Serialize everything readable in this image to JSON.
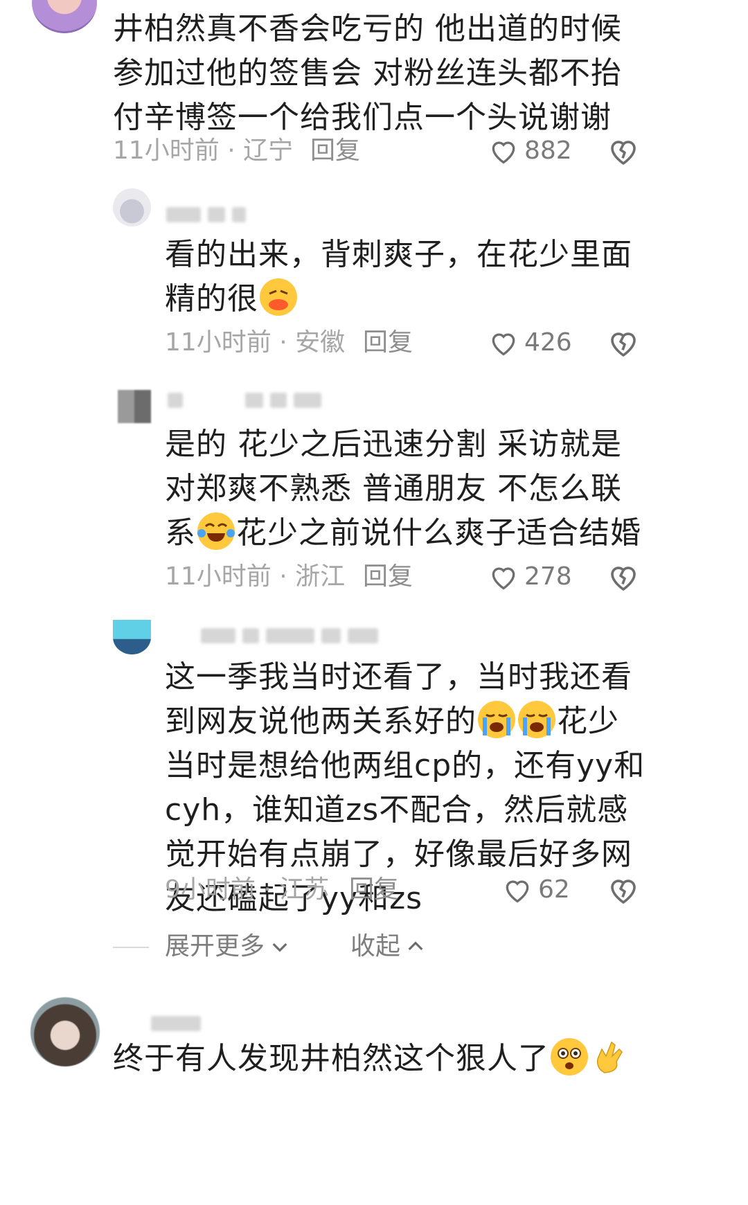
{
  "comments": [
    {
      "text": "井柏然真不香会吃亏的 他出道的时候参加过他的签售会 对粉丝连头都不抬 付辛博签一个给我们点一个头说谢谢",
      "time_location": "11小时前 · 辽宁",
      "reply_label": "回复",
      "likes": "882"
    },
    {
      "text": "看的出来，背刺爽子，在花少里面精的很",
      "time_location": "11小时前 · 安徽",
      "reply_label": "回复",
      "likes": "426"
    },
    {
      "text_a": "是的 花少之后迅速分割 采访就是对郑爽不熟悉 普通朋友 不怎么联系",
      "text_b": "花少之前说什么爽子适合结婚",
      "time_location": "11小时前 · 浙江",
      "reply_label": "回复",
      "likes": "278"
    },
    {
      "text_a": "这一季我当时还看了，当时我还看到网友说他两关系好的",
      "text_b": "花少当时是想给他两组cp的，还有yy和cyh，谁知道zs不配合，然后就感觉开始有点崩了，好像最后好多网友还磕起了yy和zs",
      "time_location": "9小时前 · 江苏",
      "reply_label": "回复",
      "likes": "62"
    },
    {
      "text": "终于有人发现井柏然这个狠人了"
    }
  ],
  "expand": {
    "more_label": "展开更多",
    "collapse_label": "收起"
  },
  "colors": {
    "meta": "#a6a6a6",
    "text": "#1f1f1f",
    "emoji": "#ffc83d"
  },
  "icons": [
    "heart-outline-icon",
    "broken-heart-icon",
    "chevron-down-icon",
    "chevron-up-icon"
  ]
}
